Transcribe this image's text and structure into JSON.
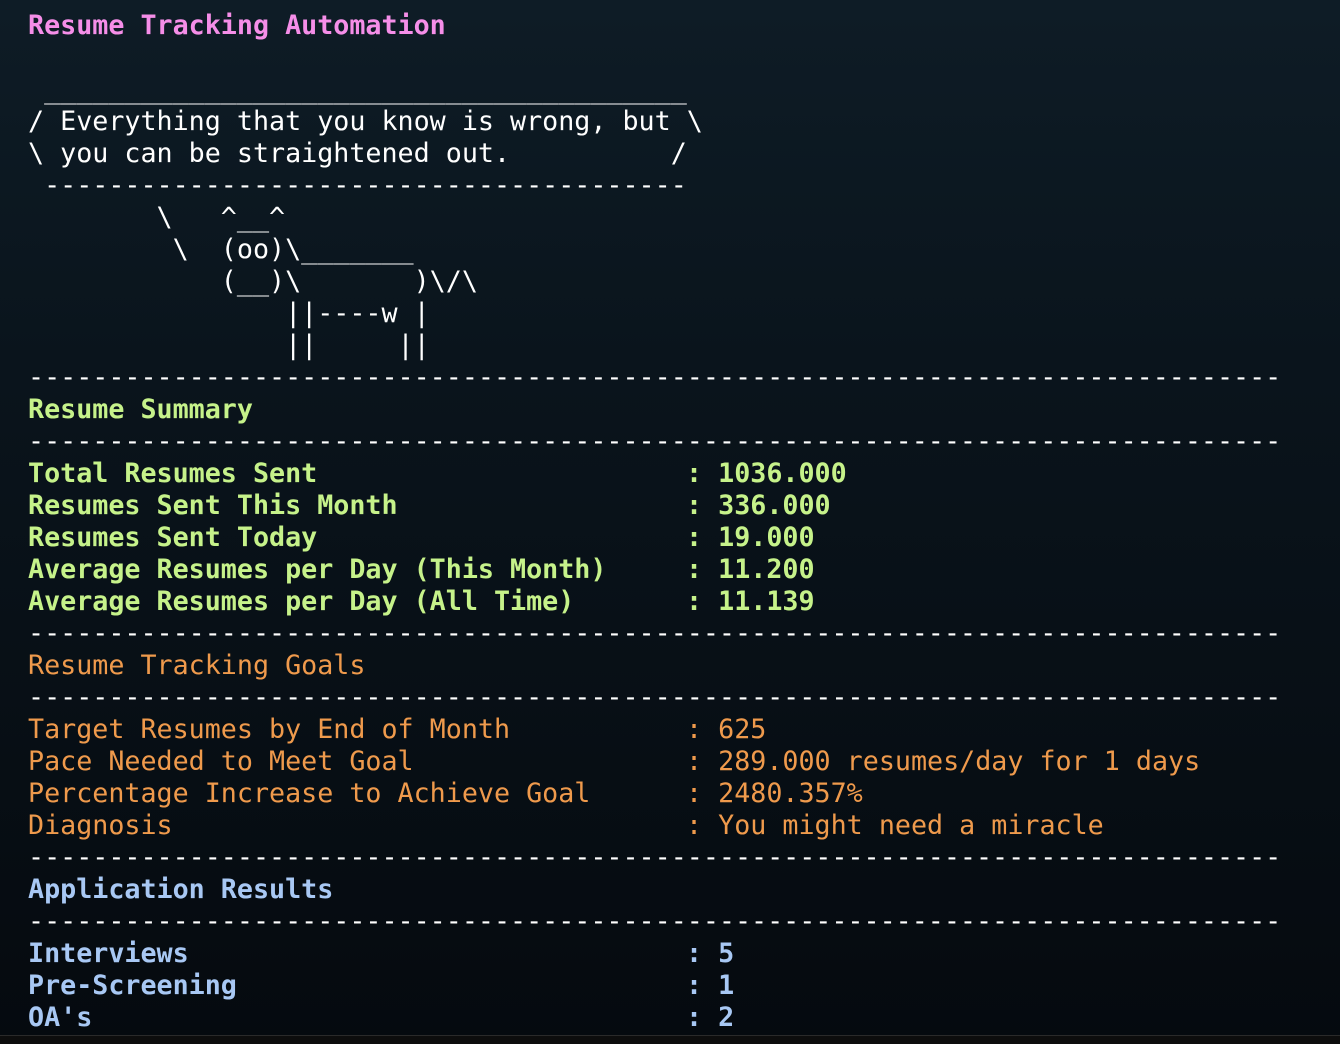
{
  "title": "Resume Tracking Automation",
  "cowsay": [
    " ________________________________________",
    "/ Everything that you know is wrong, but \\",
    "\\ you can be straightened out.          /",
    " ----------------------------------------",
    "        \\   ^__^",
    "         \\  (oo)\\_______",
    "            (__)\\       )\\/\\",
    "                ||----w |",
    "                ||     ||"
  ],
  "separator": "------------------------------------------------------------------------------",
  "summary": {
    "heading": "Resume Summary",
    "rows": [
      {
        "label": "Total Resumes Sent",
        "value": "1036.000"
      },
      {
        "label": "Resumes Sent This Month",
        "value": "336.000"
      },
      {
        "label": "Resumes Sent Today",
        "value": "19.000"
      },
      {
        "label": "Average Resumes per Day (This Month)",
        "value": "11.200"
      },
      {
        "label": "Average Resumes per Day (All Time)",
        "value": "11.139"
      }
    ]
  },
  "goals": {
    "heading": "Resume Tracking Goals",
    "rows": [
      {
        "label": "Target Resumes by End of Month",
        "value": "625"
      },
      {
        "label": "Pace Needed to Meet Goal",
        "value": "289.000 resumes/day for 1 days"
      },
      {
        "label": "Percentage Increase to Achieve Goal",
        "value": "2480.357%"
      },
      {
        "label": "Diagnosis",
        "value": "You might need a miracle"
      }
    ]
  },
  "results": {
    "heading": "Application Results",
    "rows": [
      {
        "label": "Interviews",
        "value": "5"
      },
      {
        "label": "Pre-Screening",
        "value": "1"
      },
      {
        "label": "OA's",
        "value": "2"
      }
    ]
  },
  "colon": ": ",
  "colors": {
    "title": "#f58ee8",
    "summary": "#c6f28a",
    "goals": "#ef9a4c",
    "results": "#a8c8f4",
    "background": "#0a141c"
  }
}
